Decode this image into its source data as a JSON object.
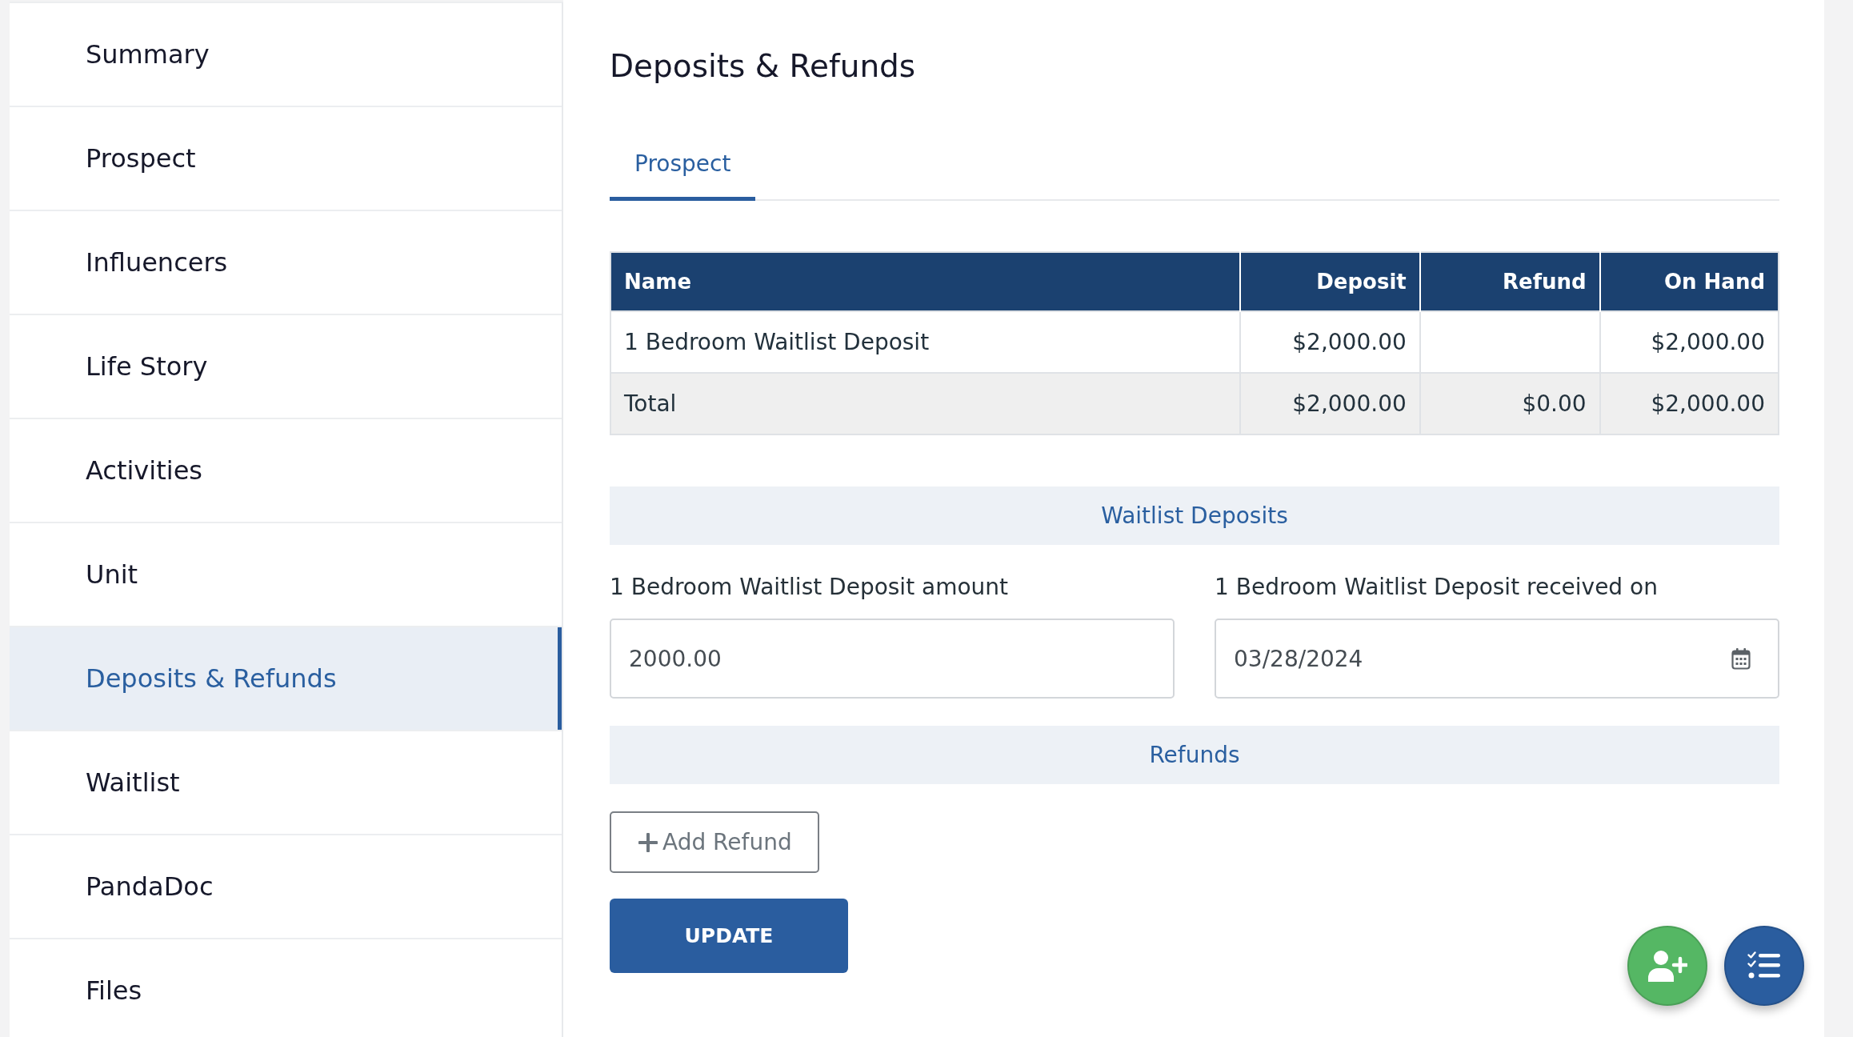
{
  "sidebar": {
    "items": [
      {
        "label": "Summary",
        "selected": false
      },
      {
        "label": "Prospect",
        "selected": false
      },
      {
        "label": "Influencers",
        "selected": false
      },
      {
        "label": "Life Story",
        "selected": false
      },
      {
        "label": "Activities",
        "selected": false
      },
      {
        "label": "Unit",
        "selected": false
      },
      {
        "label": "Deposits & Refunds",
        "selected": true
      },
      {
        "label": "Waitlist",
        "selected": false
      },
      {
        "label": "PandaDoc",
        "selected": false
      },
      {
        "label": "Files",
        "selected": false
      }
    ]
  },
  "page_title": "Deposits & Refunds",
  "tabs": [
    {
      "label": "Prospect",
      "selected": true
    }
  ],
  "table": {
    "columns": [
      "Name",
      "Deposit",
      "Refund",
      "On Hand"
    ],
    "rows": [
      {
        "kind": "item",
        "cells": [
          "1 Bedroom Waitlist Deposit",
          "$2,000.00",
          null,
          "$2,000.00"
        ]
      },
      {
        "kind": "total",
        "cells": [
          "Total",
          "$2,000.00",
          "$0.00",
          "$2,000.00"
        ]
      }
    ]
  },
  "sections": [
    {
      "title": "Waitlist Deposits",
      "fields": [
        {
          "kind": "text",
          "label": "1 Bedroom Waitlist Deposit amount",
          "value": "2000.00"
        },
        {
          "kind": "date",
          "label": "1 Bedroom Waitlist Deposit received on",
          "value": "03/28/2024"
        }
      ]
    },
    {
      "title": "Refunds",
      "buttons": [
        {
          "label": "Add Refund"
        }
      ]
    }
  ],
  "update_button": {
    "label": "UPDATE"
  },
  "floating_buttons": [
    {
      "kind": "add-person"
    },
    {
      "kind": "checklist"
    }
  ]
}
